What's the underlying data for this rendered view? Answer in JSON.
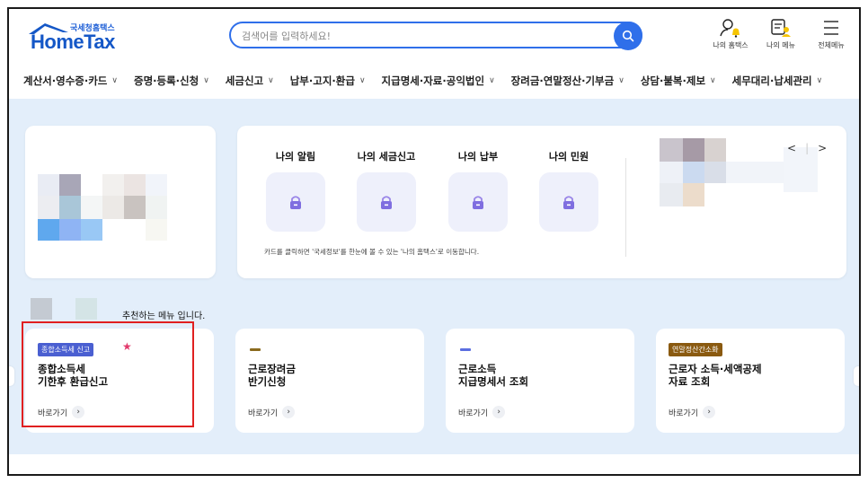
{
  "header": {
    "logo_sub": "국세청홈택스",
    "logo_main": "HomeTax",
    "search_placeholder": "검색어를 입력하세요!",
    "icons": [
      {
        "label": "나의 홈택스",
        "icon": "user-bell-icon"
      },
      {
        "label": "나의 메뉴",
        "icon": "menu-list-user-icon"
      },
      {
        "label": "전체메뉴",
        "icon": "hamburger-icon"
      }
    ]
  },
  "nav": [
    "계산서·영수증·카드",
    "증명·등록·신청",
    "세금신고",
    "납부·고지·환급",
    "지급명세·자료·공익법인",
    "장려금·연말정산·기부금",
    "상담·불복·제보",
    "세무대리·납세관리"
  ],
  "quick": [
    {
      "label": "나의 알림"
    },
    {
      "label": "나의 세금신고"
    },
    {
      "label": "나의 납부"
    },
    {
      "label": "나의 민원"
    }
  ],
  "quick_note": "카드를 클릭하면 '국세정보'를 한눈에 볼 수 있는 '나의 홈택스'로 이동합니다.",
  "pager": {
    "prev": "<",
    "next": ">"
  },
  "recommend_label": "추천하는 메뉴 입니다.",
  "menus": [
    {
      "badge": "종합소득세 신고",
      "title": "종합소득세\n기한후 환급신고",
      "go": "바로가기",
      "accent": "#4a5fd1"
    },
    {
      "badge": "",
      "title": "근로장려금\n반기신청",
      "go": "바로가기",
      "accent": "#8a6a1e"
    },
    {
      "badge": "",
      "title": "근로소득\n지급명세서 조회",
      "go": "바로가기",
      "accent": "#5b6ee0"
    },
    {
      "badge": "연말정산간소화",
      "title": "근로자 소득·세액공제\n자료 조회",
      "go": "바로가기",
      "accent": "#8a5a10"
    }
  ],
  "colors": {
    "brand": "#1457c7",
    "search": "#2f6fea",
    "bg": "#e3eefa",
    "highlight": "#e02020"
  }
}
